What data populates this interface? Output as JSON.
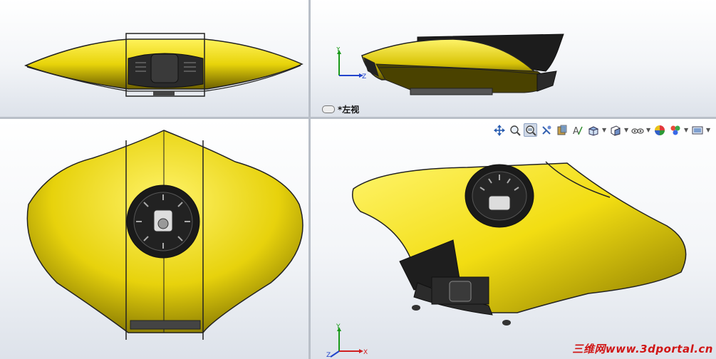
{
  "viewports": {
    "top_right": {
      "view_name": "*左视",
      "triad": {
        "y": "Y",
        "z": "Z"
      }
    },
    "bottom_right": {
      "triad": {
        "y": "Y",
        "z": "Z",
        "x": "X"
      }
    }
  },
  "toolbar": {
    "icons": [
      "move-icon",
      "zoom-to-fit-icon",
      "zoom-to-area-icon",
      "previous-view-icon",
      "section-view-icon",
      "dynamic-annotation-icon",
      "view-orientation-icon",
      "display-style-icon",
      "hide-show-icon",
      "edit-appearance-icon",
      "apply-scene-icon",
      "view-settings-icon"
    ]
  },
  "watermark": {
    "text": "三维网www.3dportal.cn"
  },
  "colors": {
    "body_yellow": "#f0e21a",
    "dark_yellow": "#5a5200",
    "black_part": "#222222",
    "split": "#b9bfc8",
    "watermark": "#d01515"
  }
}
